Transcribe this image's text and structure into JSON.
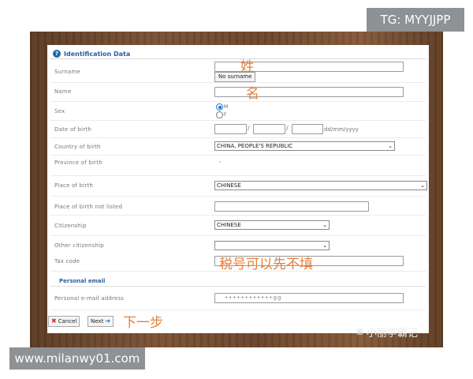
{
  "top_tag": "TG: MYYJJPP",
  "bottom_site": "www.milanwy01.com",
  "watermark": "小丽学霸记",
  "section": {
    "title": "Identification Data",
    "personal_email_title": "Personal email"
  },
  "labels": {
    "surname": "Surname",
    "name": "Name",
    "sex": "Sex",
    "dob": "Date of birth",
    "country_birth": "Country of birth",
    "province_birth": "Province of birth",
    "place_birth": "Place of birth",
    "place_not_listed": "Place of birth not listed",
    "citizenship": "Citizenship",
    "other_citizenship": "Other citizenship",
    "tax_code": "Tax code",
    "personal_email": "Personal e-mail address"
  },
  "no_surname_button": "No surname",
  "sex_options": {
    "m": "M",
    "f": "F"
  },
  "dob_sep": "/",
  "dob_format": "dd/mm/yyyy",
  "country_birth_value": "CHINA, PEOPLE'S REPUBLIC",
  "place_birth_value": "CHINESE",
  "citizenship_value": "CHINESE",
  "email_value": "••••••••••••gg",
  "buttons": {
    "cancel": "Cancel",
    "next": "Next"
  },
  "annotations": {
    "surname": "姓",
    "name": "名",
    "tax": "税号可以先不填",
    "next_step": "下一步"
  },
  "colors": {
    "header_blue": "#2b5fa3",
    "annotation_orange": "#e57f3c",
    "cancel_red": "#d62b2b"
  }
}
